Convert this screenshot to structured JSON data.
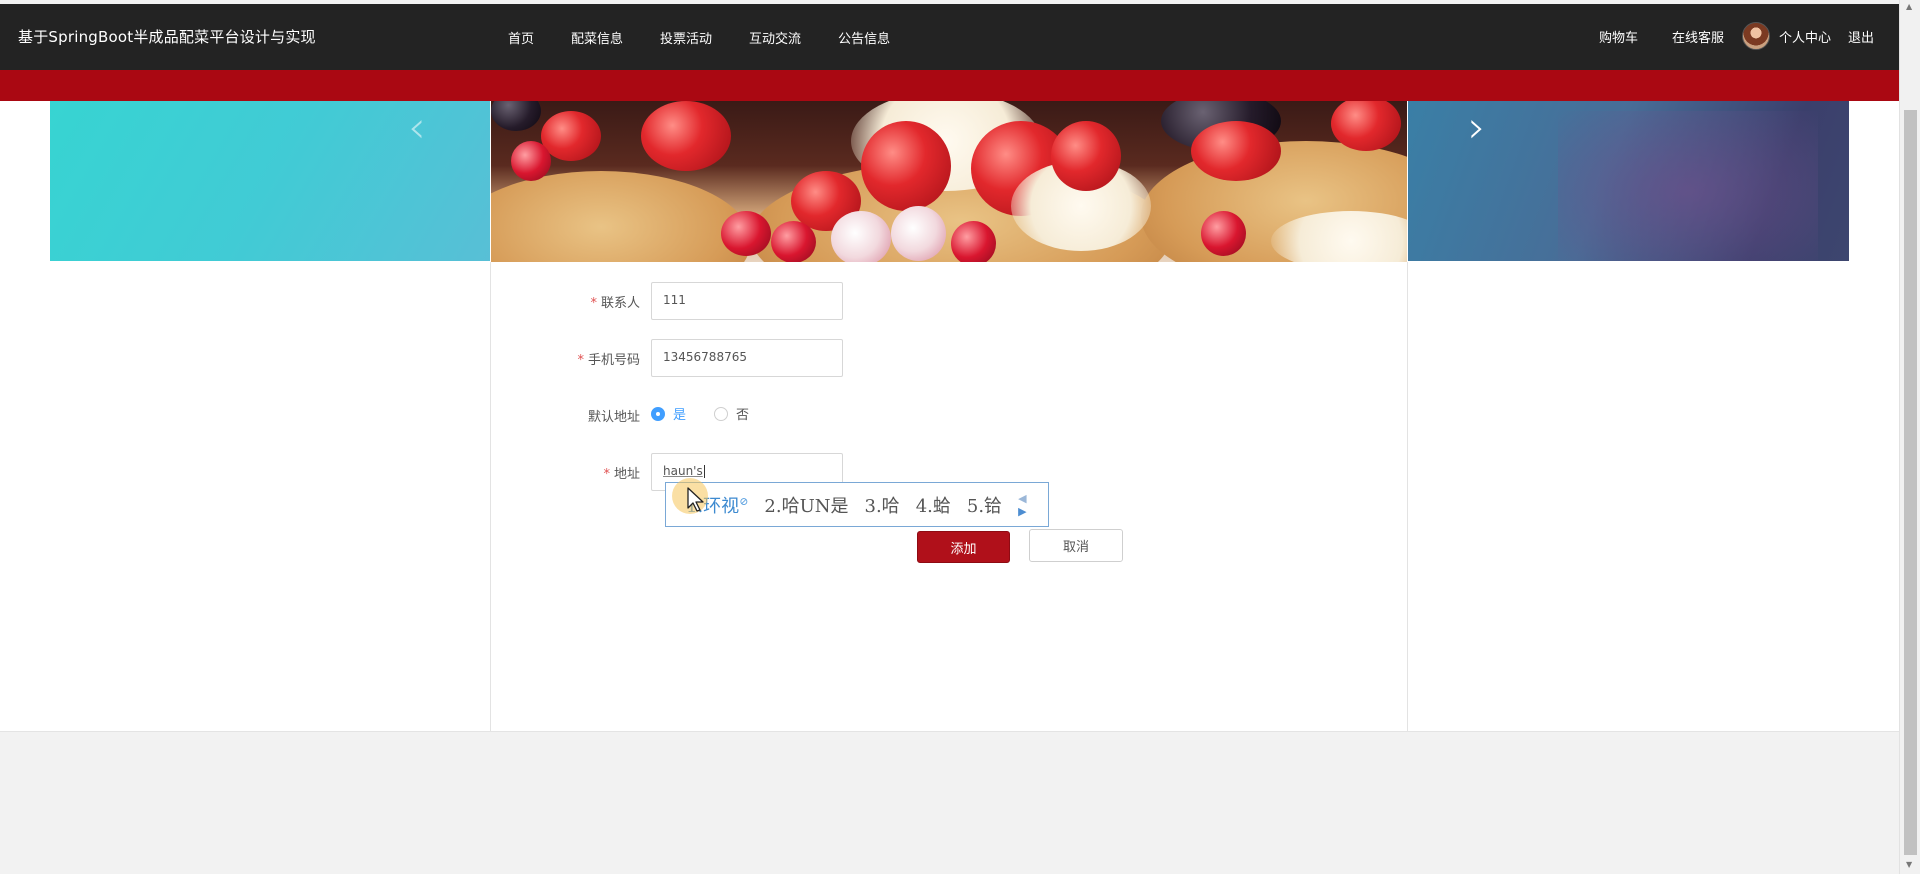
{
  "header": {
    "site_title": "基于SpringBoot半成品配菜平台设计与实现",
    "nav": [
      "首页",
      "配菜信息",
      "投票活动",
      "互动交流",
      "公告信息"
    ],
    "cart": "购物车",
    "online_service": "在线客服",
    "personal_center": "个人中心",
    "logout": "退出"
  },
  "colors": {
    "topbar": "#232323",
    "accent_red": "#aa0812",
    "primary_button": "#b0101a",
    "radio_active": "#409eff"
  },
  "form": {
    "contact": {
      "label": "联系人",
      "required": "*",
      "value": "111"
    },
    "phone": {
      "label": "手机号码",
      "required": "*",
      "value": "13456788765"
    },
    "default_address": {
      "label": "默认地址",
      "options": [
        {
          "label": "是",
          "checked": true
        },
        {
          "label": "否",
          "checked": false
        }
      ]
    },
    "address": {
      "label": "地址",
      "required": "*",
      "value": "haun's"
    },
    "add_button": "添加",
    "cancel_button": "取消"
  },
  "ime": {
    "candidates": [
      "1.环视",
      "2.哈UN是",
      "3.哈",
      "4.蛤",
      "5.铪"
    ]
  }
}
